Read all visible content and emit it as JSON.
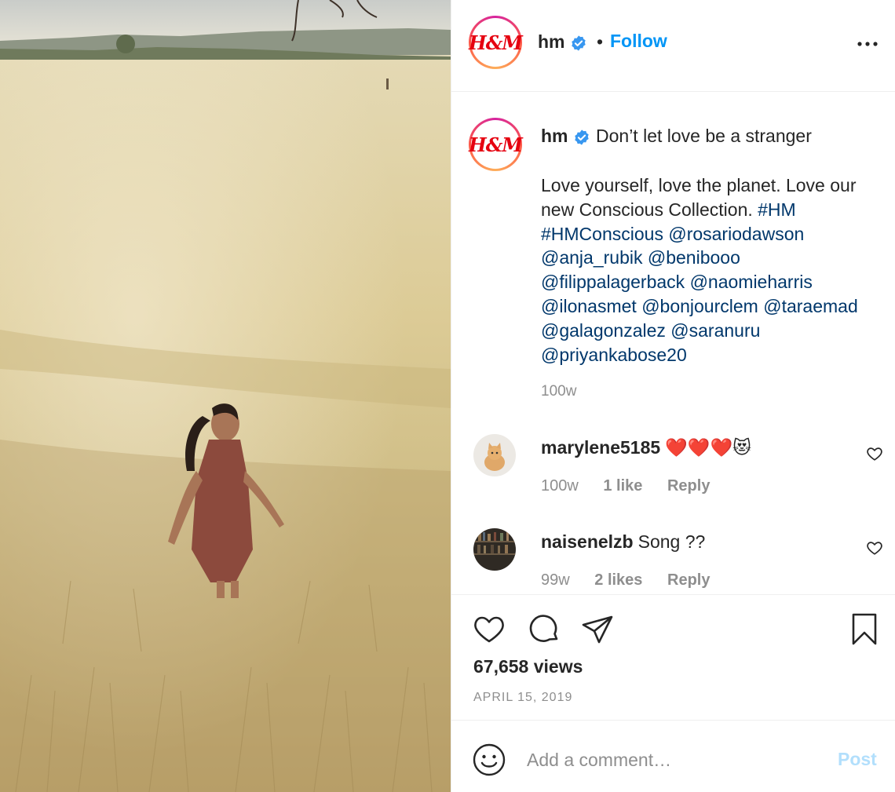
{
  "post": {
    "author": "hm",
    "verified": true,
    "follow_label": "Follow",
    "dot": "•",
    "logo_text": "H&M"
  },
  "caption": {
    "author": "hm",
    "title": "Don’t let love be a stranger",
    "body_plain": "Love yourself, love the planet. Love our new Conscious Collection.",
    "hashtags": [
      "#HM",
      "#HMConscious"
    ],
    "mentions": [
      "@rosariodawson",
      "@anja_rubik",
      "@benibooo",
      "@filippalagerback",
      "@naomieharris",
      "@ilonasmet",
      "@bonjourclem",
      "@taraemad",
      "@galagonzalez",
      "@saranuru",
      "@priyankabose20"
    ],
    "time": "100w"
  },
  "comments": [
    {
      "user": "marylene5185",
      "text": "❤️❤️❤️😻",
      "time": "100w",
      "likes": "1 like",
      "reply": "Reply",
      "avatar": "cat-photo"
    },
    {
      "user": "naisenelzb",
      "text": "Song ??",
      "time": "99w",
      "likes": "2 likes",
      "reply": "Reply",
      "avatar": "bookshelf-photo"
    }
  ],
  "actions": {
    "icons": [
      "heart-icon",
      "comment-icon",
      "share-icon",
      "bookmark-icon"
    ],
    "views": "67,658 views",
    "date": "APRIL 15, 2019"
  },
  "add_comment": {
    "placeholder": "Add a comment…",
    "post_label": "Post"
  },
  "colors": {
    "link_blue": "#0095f6",
    "tag_blue": "#00376b",
    "muted": "#8e8e8e",
    "post_disabled": "#b2dffc",
    "brand_red": "#e50010"
  }
}
